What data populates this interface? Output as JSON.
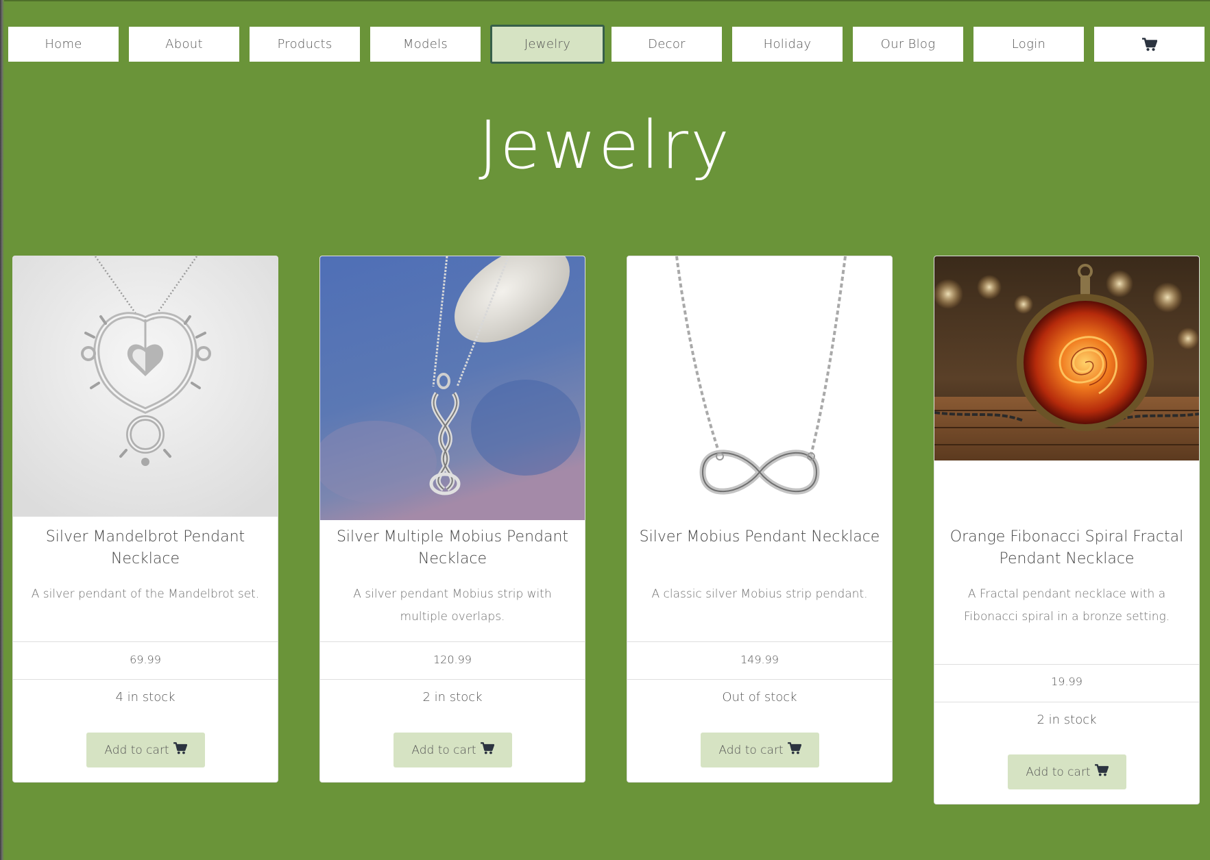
{
  "nav": {
    "items": [
      {
        "label": "Home"
      },
      {
        "label": "About"
      },
      {
        "label": "Products"
      },
      {
        "label": "Models"
      },
      {
        "label": "Jewelry",
        "active": true
      },
      {
        "label": "Decor"
      },
      {
        "label": "Holiday"
      },
      {
        "label": "Our Blog"
      },
      {
        "label": "Login"
      },
      {
        "icon": "shopping-cart-icon"
      }
    ]
  },
  "page": {
    "title": "Jewelry"
  },
  "products": [
    {
      "image_icon": "mandelbrot-pendant-image",
      "title": "Silver Mandelbrot Pendant Necklace",
      "description": "A silver pendant of the Mandelbrot set.",
      "price": "69.99",
      "stock": "4 in stock",
      "button_label": "Add to cart"
    },
    {
      "image_icon": "multiple-mobius-pendant-image",
      "title": "Silver Multiple Mobius Pendant Necklace",
      "description": "A silver pendant Mobius strip with multiple overlaps.",
      "price": "120.99",
      "stock": "2 in stock",
      "button_label": "Add to cart"
    },
    {
      "image_icon": "mobius-pendant-image",
      "title": "Silver Mobius Pendant Necklace",
      "description": "A classic silver Mobius strip pendant.",
      "price": "149.99",
      "stock": "Out of stock",
      "button_label": "Add to cart"
    },
    {
      "image_icon": "fibonacci-spiral-pendant-image",
      "title": "Orange Fibonacci Spiral Fractal Pendant Necklace",
      "description": "A Fractal pendant necklace with a Fibonacci spiral in a bronze setting.",
      "price": "19.99",
      "stock": "2 in stock",
      "button_label": "Add to cart"
    }
  ],
  "colors": {
    "page_background": "#6a9439",
    "nav_active": "#d6e3c3",
    "nav_active_border": "#375f4a",
    "button": "#d6e3c3",
    "text": "#555555"
  }
}
